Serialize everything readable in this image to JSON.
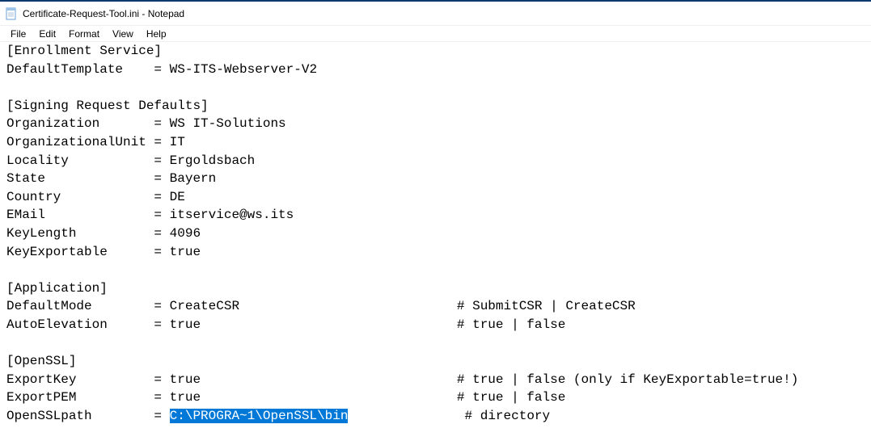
{
  "window": {
    "title": "Certificate-Request-Tool.ini - Notepad"
  },
  "menu": {
    "file": "File",
    "edit": "Edit",
    "format": "Format",
    "view": "View",
    "help": "Help"
  },
  "editor": {
    "pre_text": "[Enrollment Service]\nDefaultTemplate    = WS-ITS-Webserver-V2\n\n[Signing Request Defaults]\nOrganization       = WS IT-Solutions\nOrganizationalUnit = IT\nLocality           = Ergoldsbach\nState              = Bayern\nCountry            = DE\nEMail              = itservice@ws.its\nKeyLength          = 4096\nKeyExportable      = true\n\n[Application]\nDefaultMode        = CreateCSR                            # SubmitCSR | CreateCSR\nAutoElevation      = true                                 # true | false\n\n[OpenSSL]\nExportKey          = true                                 # true | false (only if KeyExportable=true!)\nExportPEM          = true                                 # true | false\nOpenSSLpath        = ",
    "highlight_text": "C:\\PROGRA~1\\OpenSSL\\bin",
    "post_text": "               # directory"
  }
}
